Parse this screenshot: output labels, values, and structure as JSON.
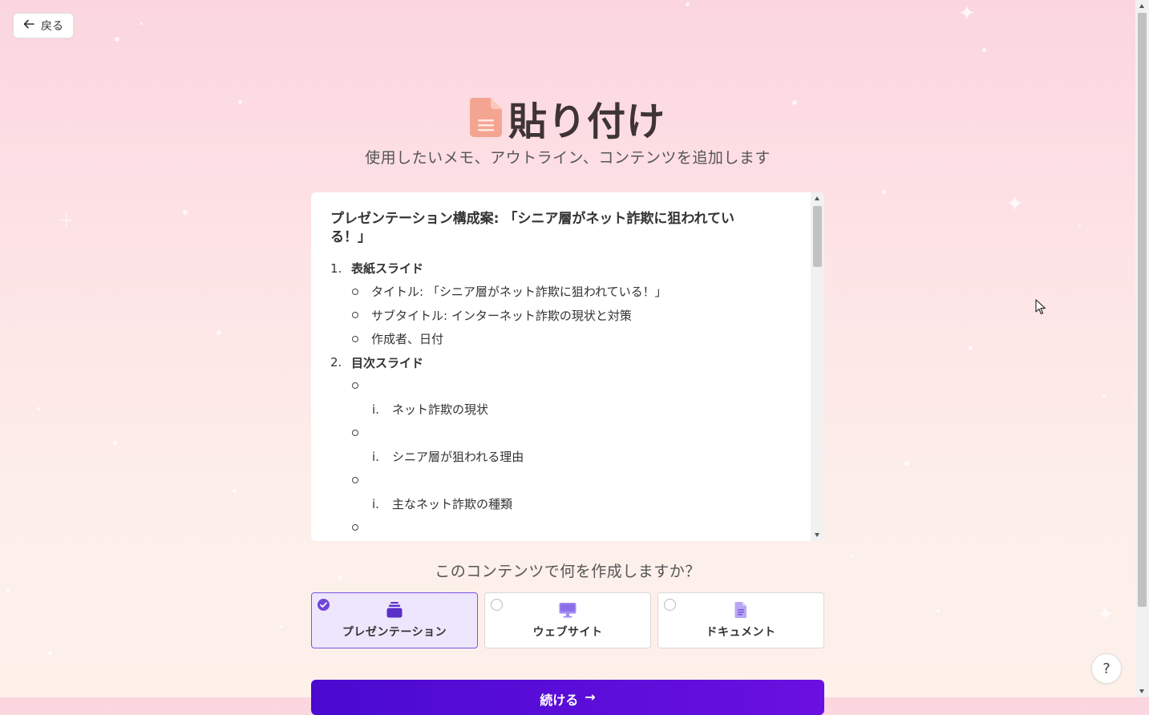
{
  "back_button": {
    "label": "戻る",
    "icon": "arrow-left-icon"
  },
  "header": {
    "icon": "document-icon",
    "title": "貼り付け",
    "subtitle": "使用したいメモ、アウトライン、コンテンツを追加します"
  },
  "editor": {
    "doc_title_line1": "プレゼンテーション構成案: 「シニア層がネット詐欺に狙われてい",
    "doc_title_line2": "る！」",
    "sections": [
      {
        "number": "1.",
        "title": "表紙スライド",
        "bullets": [
          "タイトル: 「シニア層がネット詐欺に狙われている！」",
          "サブタイトル: インターネット詐欺の現状と対策",
          "作成者、日付"
        ]
      },
      {
        "number": "2.",
        "title": "目次スライド",
        "sub_items": [
          {
            "roman": "i.",
            "text": "ネット詐欺の現状"
          },
          {
            "roman": "i.",
            "text": "シニア層が狙われる理由"
          },
          {
            "roman": "i.",
            "text": "主なネット詐欺の種類"
          }
        ]
      }
    ]
  },
  "question": "このコンテンツで何を作成しますか？",
  "options": [
    {
      "label": "プレゼンテーション",
      "icon": "presentation-stack-icon",
      "selected": true
    },
    {
      "label": "ウェブサイト",
      "icon": "monitor-icon",
      "selected": false
    },
    {
      "label": "ドキュメント",
      "icon": "document-icon",
      "selected": false
    }
  ],
  "continue_button": {
    "label": "続ける",
    "icon": "arrow-right-icon"
  },
  "help_button": {
    "label": "?"
  },
  "colors": {
    "accent": "#7046d6",
    "continue_button": "#5a0ed8",
    "title_icon": "#f2a491",
    "selected_option_bg": "#ede6fd"
  }
}
